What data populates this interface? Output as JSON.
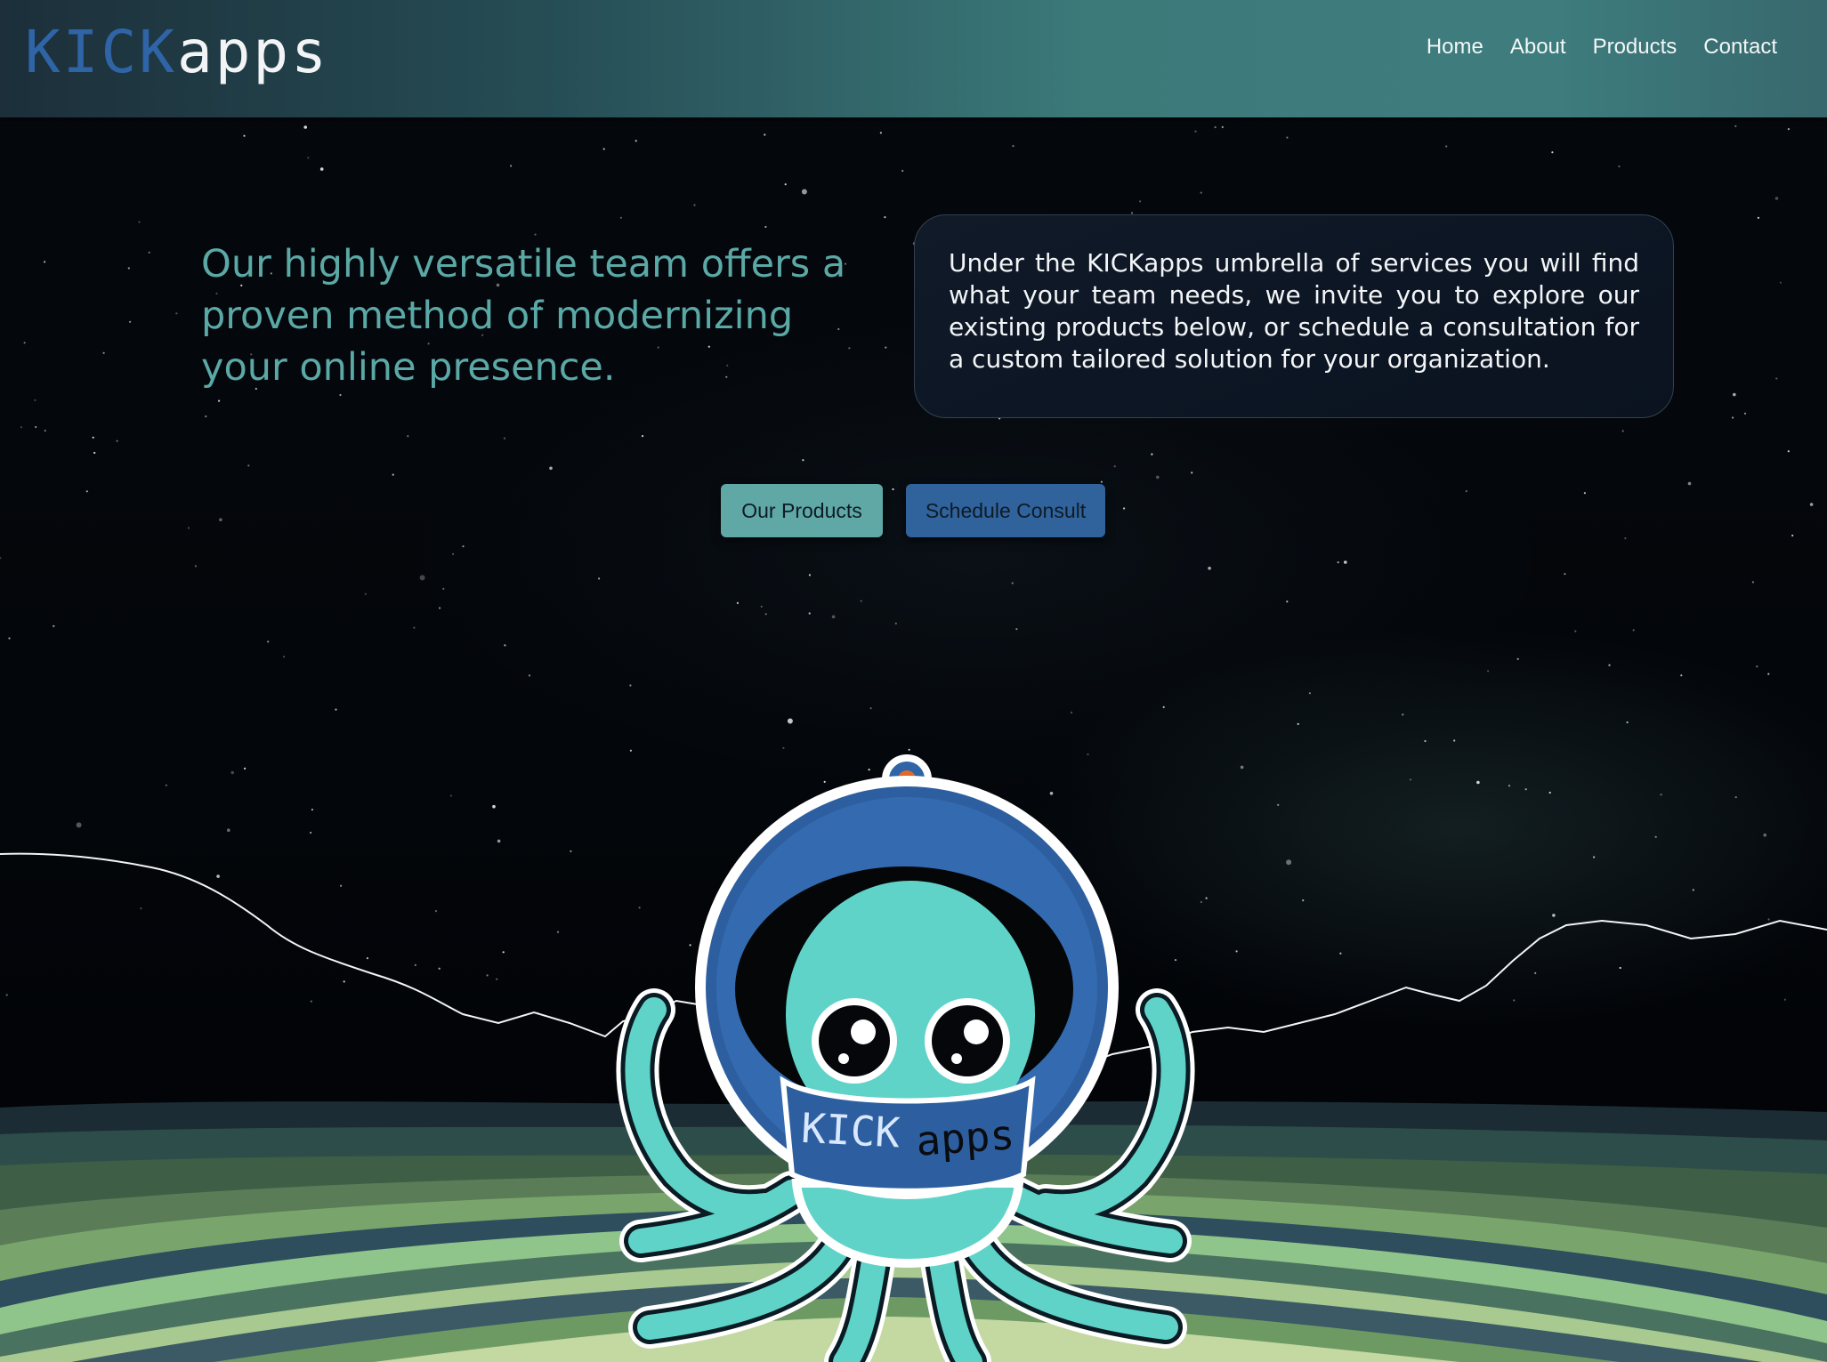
{
  "header": {
    "logo": {
      "kick": "KICK",
      "apps": "apps"
    },
    "nav": [
      {
        "label": "Home"
      },
      {
        "label": "About"
      },
      {
        "label": "Products"
      },
      {
        "label": "Contact"
      }
    ]
  },
  "hero": {
    "headline": "Our highly versatile team offers a proven method of modernizing your online presence.",
    "info": "Under the KICKapps umbrella of services you will find what your team needs, we invite you to explore our existing products below, or schedule a consultation for a custom tailored solution for your organization.",
    "buttons": {
      "products": "Our Products",
      "consult": "Schedule Consult"
    }
  },
  "mascot": {
    "helmet_text_kick": "KICK",
    "helmet_text_apps": "apps"
  },
  "colors": {
    "accent_teal": "#5fa8a6",
    "accent_blue": "#30629c",
    "brand_blue": "#2f64a6",
    "mascot_teal": "#5fd3c8"
  },
  "icons": [
    "kickapps-logo",
    "octopus-astronaut-mascot"
  ]
}
